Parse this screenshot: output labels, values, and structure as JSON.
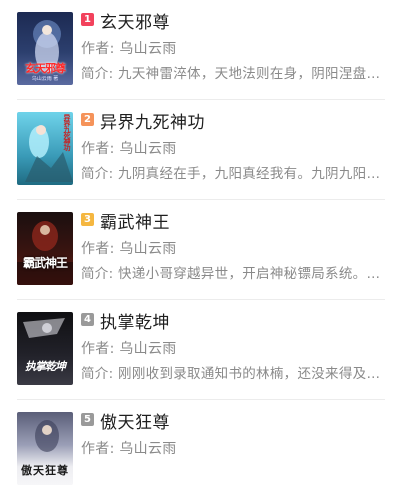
{
  "books": [
    {
      "rank": "1",
      "rank_color": "#f2425c",
      "title": "玄天邪尊",
      "author": "作者: 乌山云雨",
      "summary": "简介: 九天神雷淬体，天地法则在身，阴阳涅盘…",
      "cover": {
        "title": "玄天邪尊",
        "author": "乌山云雨 著",
        "bg_top": "#1c2a52",
        "bg_bottom": "#3a4a7c",
        "title_color": "#ff2a2a"
      }
    },
    {
      "rank": "2",
      "rank_color": "#f5935a",
      "title": "异界九死神功",
      "author": "作者: 乌山云雨",
      "summary": "简介: 九阴真经在手，九阳真经我有。九阴九阳…",
      "cover": {
        "title": "异界九死神功",
        "author": "",
        "bg_top": "#5fc8e0",
        "bg_bottom": "#2a7f99",
        "title_color": "#c81e1e"
      }
    },
    {
      "rank": "3",
      "rank_color": "#f5b740",
      "title": "霸武神王",
      "author": "作者: 乌山云雨",
      "summary": "简介: 快递小哥穿越异世，开启神秘镖局系统。…",
      "cover": {
        "title": "霸武神王",
        "author": "",
        "bg_top": "#1a0f0f",
        "bg_bottom": "#5a1a14",
        "title_color": "#ffffff"
      }
    },
    {
      "rank": "4",
      "rank_color": "#9a9a9a",
      "title": "执掌乾坤",
      "author": "作者: 乌山云雨",
      "summary": "简介: 刚刚收到录取通知书的林楠，还没来得及…",
      "cover": {
        "title": "执掌乾坤",
        "author": "",
        "bg_top": "#0f0f12",
        "bg_bottom": "#2a2a32",
        "title_color": "#ffffff"
      }
    },
    {
      "rank": "5",
      "rank_color": "#9a9a9a",
      "title": "傲天狂尊",
      "author": "作者: 乌山云雨",
      "summary": "",
      "cover": {
        "title": "傲天狂尊",
        "author": "",
        "bg_top": "#6b6f88",
        "bg_bottom": "#e6e6ea",
        "title_color": "#1a1a1a"
      }
    }
  ]
}
